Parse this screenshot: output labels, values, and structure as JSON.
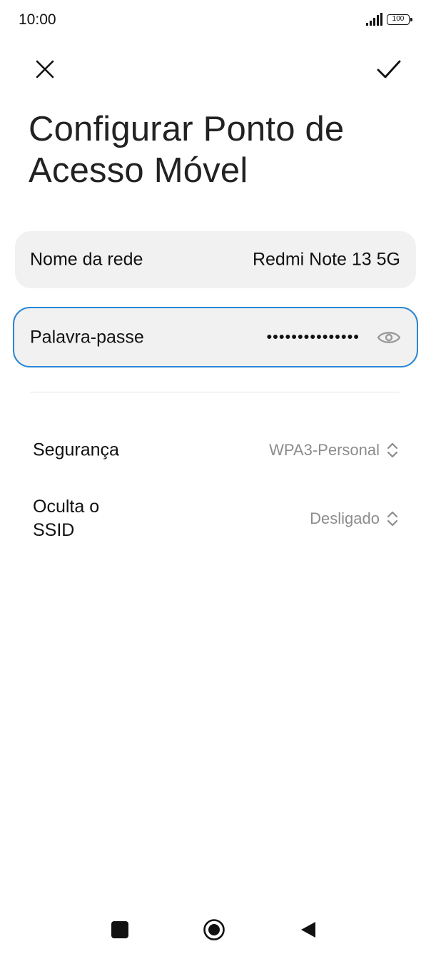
{
  "status_bar": {
    "time": "10:00",
    "battery_level": "100"
  },
  "header": {
    "close_icon": "close-icon",
    "confirm_icon": "check-icon"
  },
  "title": "Configurar Ponto de Acesso Móvel",
  "fields": {
    "network_name": {
      "label": "Nome da rede",
      "value": "Redmi Note 13 5G"
    },
    "password": {
      "label": "Palavra-passe",
      "value": "•••••••••••••••",
      "visibility_icon": "eye-icon"
    }
  },
  "settings": {
    "security": {
      "label": "Segurança",
      "value": "WPA3-Personal"
    },
    "hide_ssid": {
      "label": "Oculta o\nSSID",
      "value": "Desligado"
    }
  },
  "navigation": {
    "recent_icon": "square-icon",
    "home_icon": "circle-icon",
    "back_icon": "triangle-back-icon"
  },
  "colors": {
    "accent": "#2a86d6",
    "card_background": "#f1f1f1",
    "secondary_text": "#8c8c8c"
  }
}
